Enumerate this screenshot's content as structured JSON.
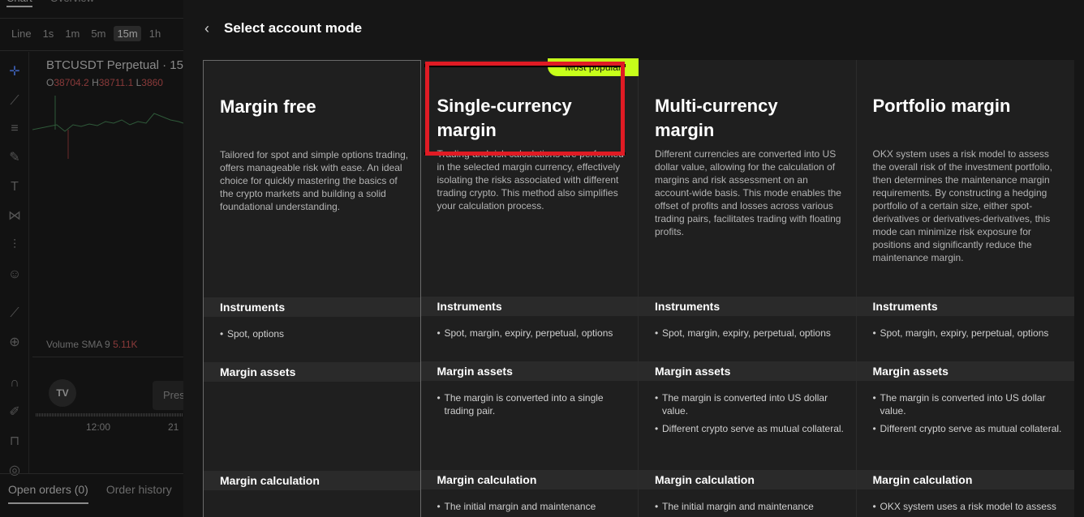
{
  "background": {
    "top_tabs": [
      "Chart",
      "Overview"
    ],
    "timeframes": [
      "Line",
      "1s",
      "1m",
      "5m",
      "15m",
      "1h"
    ],
    "active_timeframe": "15m",
    "symbol": "BTCUSDT Perpetual · 15",
    "ohlc": {
      "o_label": "O",
      "o_value": "38704.2",
      "h_label": "H",
      "h_value": "38711.1",
      "l_label": "L",
      "l_value": "3860"
    },
    "volume": {
      "label": "Volume",
      "sma_label": "SMA 9",
      "value": "5.11K"
    },
    "tv_logo": "TV",
    "press_text": "Pres",
    "x_ticks": [
      "12:00",
      "21"
    ],
    "bottom_tabs": [
      "Open orders (0)",
      "Order history"
    ]
  },
  "modal": {
    "back_icon": "chevron-left-icon",
    "title": "Select account mode",
    "badge": "Most popular",
    "modes": [
      {
        "name": "Margin free",
        "description": "Tailored for spot and simple options trading, offers manageable risk with ease. An ideal choice for quickly mastering the basics of the crypto markets and building a solid foundational understanding.",
        "instruments_title": "Instruments",
        "instruments": [
          "Spot, options"
        ],
        "margin_assets_title": "Margin assets",
        "margin_assets": [],
        "margin_calc_title": "Margin calculation",
        "margin_calc": []
      },
      {
        "name": "Single-currency margin",
        "description": "Trading and risk calculations are performed in the selected margin currency, effectively isolating the risks associated with different trading crypto. This method also simplifies your calculation process.",
        "instruments_title": "Instruments",
        "instruments": [
          "Spot, margin, expiry, perpetual, options"
        ],
        "margin_assets_title": "Margin assets",
        "margin_assets": [
          "The margin is converted into a single trading pair."
        ],
        "margin_calc_title": "Margin calculation",
        "margin_calc": [
          "The initial margin and maintenance"
        ]
      },
      {
        "name": "Multi-currency margin",
        "description": "Different currencies are converted into US dollar value, allowing for the calculation of margins and risk assessment on an account-wide basis. This mode enables the offset of profits and losses across various trading pairs, facilitates trading with floating profits.",
        "instruments_title": "Instruments",
        "instruments": [
          "Spot, margin, expiry, perpetual, options"
        ],
        "margin_assets_title": "Margin assets",
        "margin_assets": [
          "The margin is converted into US dollar value.",
          "Different crypto serve as mutual collateral."
        ],
        "margin_calc_title": "Margin calculation",
        "margin_calc": [
          "The initial margin and maintenance"
        ]
      },
      {
        "name": "Portfolio margin",
        "description": "OKX system uses a risk model to assess the overall risk of the investment portfolio, then determines the maintenance margin requirements. By constructing a hedging portfolio of a certain size, either spot-derivatives or derivatives-derivatives, this mode can minimize risk exposure for positions and significantly reduce the maintenance margin.",
        "instruments_title": "Instruments",
        "instruments": [
          "Spot, margin, expiry, perpetual, options"
        ],
        "margin_assets_title": "Margin assets",
        "margin_assets": [
          "The margin is converted into US dollar value.",
          "Different crypto serve as mutual collateral."
        ],
        "margin_calc_title": "Margin calculation",
        "margin_calc": [
          "OKX system uses a risk model to assess"
        ]
      }
    ]
  },
  "colors": {
    "accent_badge": "#c6ff1a",
    "highlight_box": "#e01b24",
    "panel_bg": "#161616",
    "card_bg": "#1f1f1f"
  }
}
